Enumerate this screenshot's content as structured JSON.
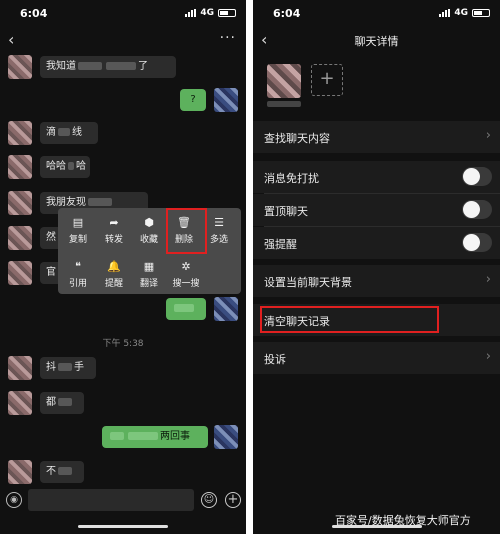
{
  "left_screen": {
    "status": {
      "time": "6:04",
      "network": "4G"
    },
    "messages": [
      {
        "side": "in",
        "pre": "我知道",
        "post": "了"
      },
      {
        "side": "out",
        "pre": "?",
        "post": ""
      },
      {
        "side": "in",
        "pre": "滴",
        "post": "线"
      },
      {
        "side": "in",
        "pre": "哈哈",
        "post": "哈"
      },
      {
        "side": "in",
        "pre": "我朋友现",
        "post": ""
      },
      {
        "side": "in",
        "pre": "然",
        "post": ""
      },
      {
        "side": "in",
        "pre": "官",
        "post": ""
      },
      {
        "side": "out",
        "pre": "",
        "post": ""
      },
      {
        "side": "in",
        "pre": "抖",
        "post": "手"
      },
      {
        "side": "in",
        "pre": "都",
        "post": ""
      },
      {
        "side": "out",
        "pre": "",
        "post": "两回事"
      },
      {
        "side": "in",
        "pre": "不",
        "post": ""
      }
    ],
    "context_menu": {
      "items": [
        {
          "icon": "▤",
          "label": "复制"
        },
        {
          "icon": "➦",
          "label": "转发"
        },
        {
          "icon": "⬢",
          "label": "收藏"
        },
        {
          "icon": "🗑",
          "label": "删除"
        },
        {
          "icon": "☰",
          "label": "多选"
        },
        {
          "icon": "❝",
          "label": "引用"
        },
        {
          "icon": "🔔",
          "label": "提醒"
        },
        {
          "icon": "▦",
          "label": "翻译"
        },
        {
          "icon": "✲",
          "label": "搜一搜"
        }
      ]
    },
    "time_divider": "下午 5:38"
  },
  "right_screen": {
    "status": {
      "time": "6:04",
      "network": "4G"
    },
    "title": "聊天详情",
    "add_member_icon": "+",
    "rows": [
      {
        "label": "查找聊天内容"
      },
      {
        "label": "消息免打扰"
      },
      {
        "label": "置顶聊天"
      },
      {
        "label": "强提醒"
      },
      {
        "label": "设置当前聊天背景"
      },
      {
        "label": "清空聊天记录"
      },
      {
        "label": "投诉"
      }
    ]
  },
  "watermark": "百家号/数据兔恢复大师官方",
  "colors": {
    "highlight": "#e02020",
    "bubble_out": "#5db15d",
    "bubble_in": "#2c2c2c",
    "background": "#111111"
  }
}
